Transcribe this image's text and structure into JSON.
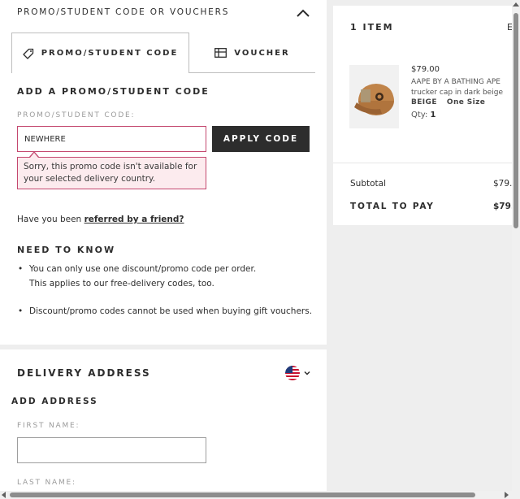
{
  "promo": {
    "section_title": "PROMO/STUDENT CODE OR VOUCHERS",
    "tabs": [
      {
        "label": "PROMO/STUDENT CODE",
        "icon": "tag-icon",
        "active": true
      },
      {
        "label": "VOUCHER",
        "icon": "voucher-icon",
        "active": false
      }
    ],
    "form_heading": "ADD A PROMO/STUDENT CODE",
    "code_label": "PROMO/STUDENT CODE:",
    "code_value": "NEWHERE",
    "apply_label": "APPLY CODE",
    "error_message": "Sorry, this promo code isn't available for your selected delivery country.",
    "referral_text": "Have you been ",
    "referral_link": "referred by a friend?",
    "need_to_know_heading": "NEED TO KNOW",
    "notes": [
      {
        "line1": "You can only use one discount/promo code per order.",
        "line2": "This applies to our free-delivery codes, too."
      },
      {
        "line1": "Discount/promo codes cannot be used when buying gift vouchers."
      }
    ]
  },
  "delivery": {
    "heading": "DELIVERY ADDRESS",
    "country_icon": "us-flag-icon",
    "add_address": "ADD ADDRESS",
    "first_name_label": "FIRST NAME:",
    "first_name_value": "",
    "last_name_label": "LAST NAME:"
  },
  "summary": {
    "item_count": "1 ITEM",
    "edit_label": "E",
    "product": {
      "price": "$79.00",
      "name": "AAPE BY A BATHING APE trucker cap in dark beige",
      "colour": "BEIGE",
      "size": "One Size",
      "qty_label": "Qty:",
      "qty": "1"
    },
    "subtotal_label": "Subtotal",
    "subtotal_value": "$79.",
    "total_label": "TOTAL TO PAY",
    "total_value": "$79."
  },
  "colors": {
    "primary_button": "#2d2d2d",
    "error_border": "#c4486f",
    "error_background": "#fcebee",
    "page_background": "#eeeeee"
  }
}
